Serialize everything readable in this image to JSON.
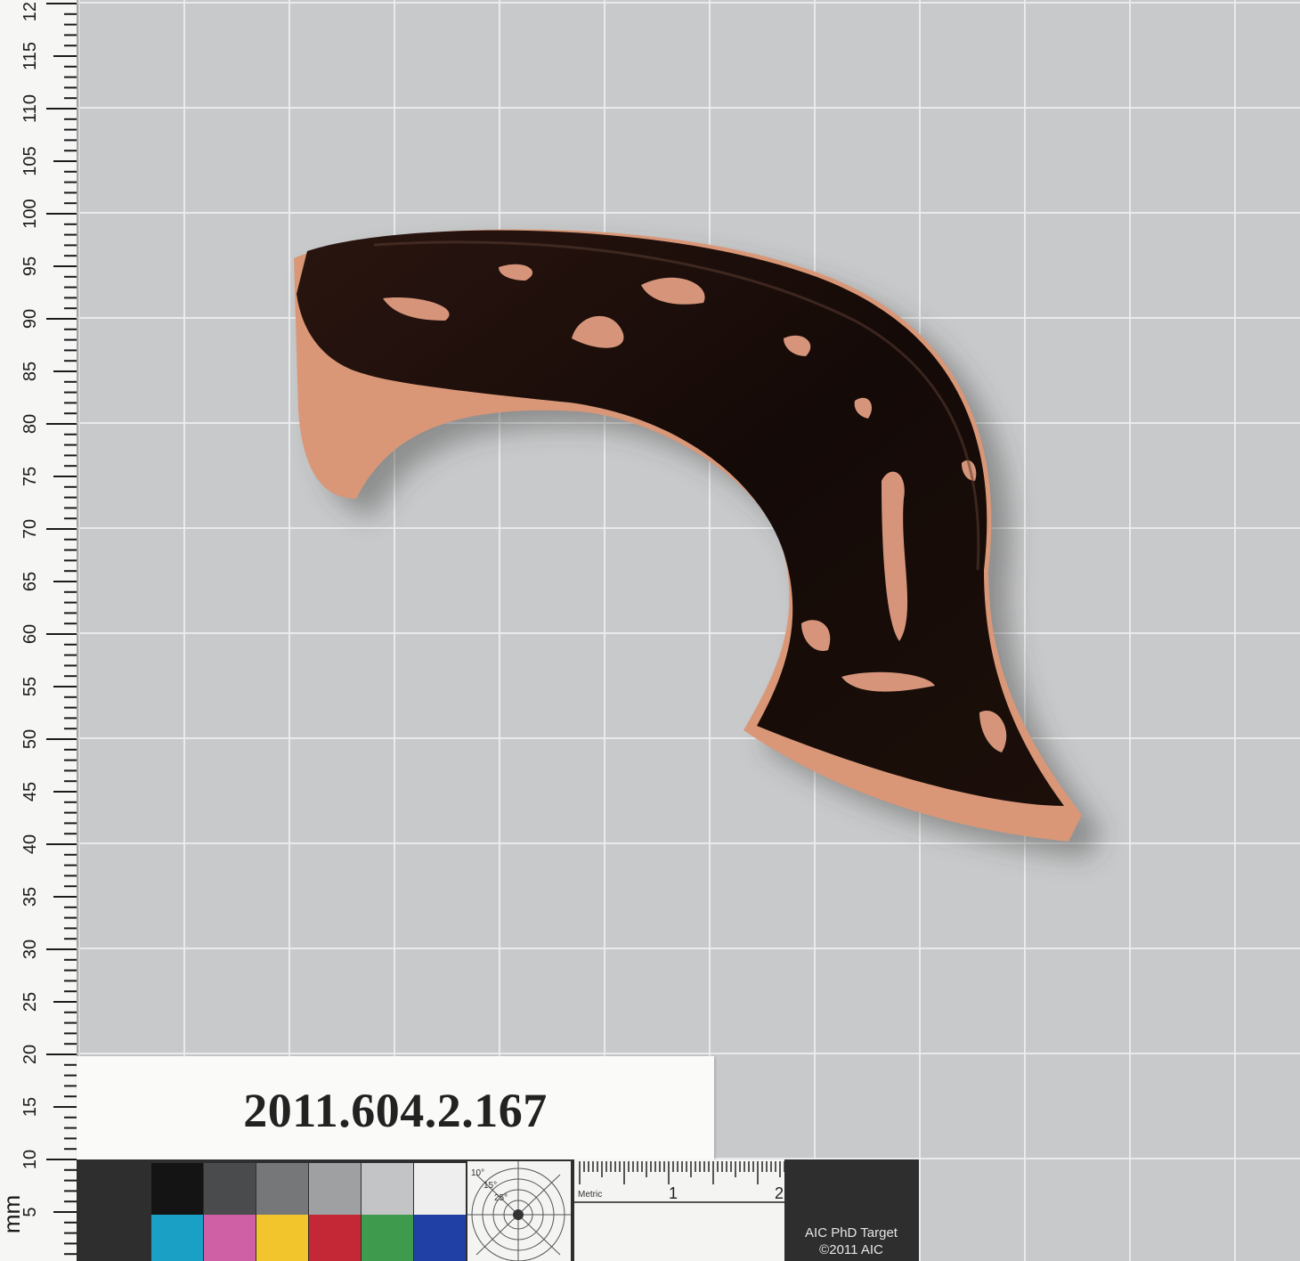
{
  "ruler": {
    "unit_label": "mm",
    "tick_labels": [
      "115",
      "110",
      "105",
      "100",
      "95",
      "90",
      "85",
      "80",
      "75",
      "70",
      "65",
      "60",
      "55",
      "50",
      "45",
      "40",
      "35",
      "30",
      "25",
      "20",
      "15",
      "10",
      "5"
    ],
    "top_partial": "12"
  },
  "label_card": {
    "accession_number": "2011.604.2.167"
  },
  "color_target": {
    "title": "AIC PhD Target",
    "copyright": "©2011 AIC",
    "scale_label": "Metric",
    "scale_numbers": [
      "1",
      "2"
    ],
    "angle_labels": [
      "10°",
      "15°",
      "25°"
    ],
    "gray_swatches": [
      "#141414",
      "#4a4b4d",
      "#767778",
      "#9fa0a1",
      "#c3c4c5",
      "#eeeeee"
    ],
    "color_swatches": [
      "#1aa0c4",
      "#d060a5",
      "#f1c52b",
      "#c42837",
      "#3e9a4c",
      "#2140a6"
    ]
  },
  "object": {
    "name": "terracotta-handle-fragment",
    "glaze": "#1a0f0a",
    "clay": "#dd9a78"
  }
}
